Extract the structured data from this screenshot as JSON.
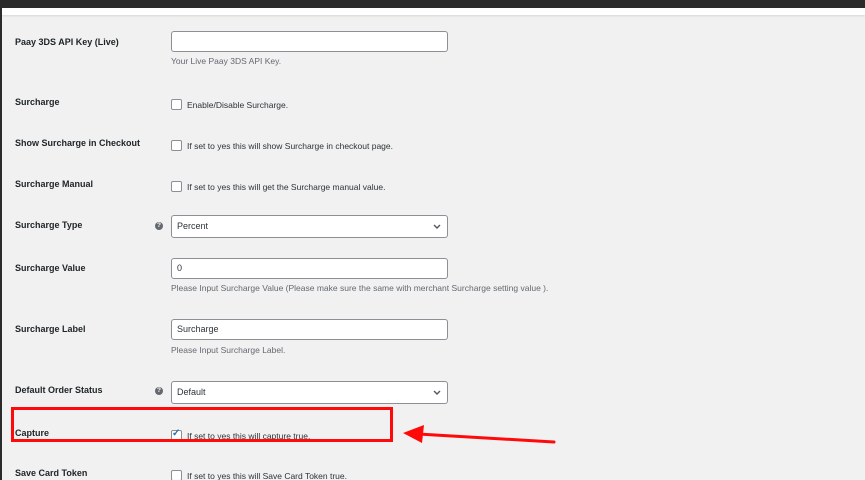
{
  "fields": {
    "api_key_live": {
      "label": "Paay 3DS API Key (Live)",
      "value": "",
      "description": "Your Live Paay 3DS API Key."
    },
    "surcharge": {
      "label": "Surcharge",
      "checkbox_text": "Enable/Disable Surcharge.",
      "checked": false
    },
    "show_surcharge_checkout": {
      "label": "Show Surcharge in Checkout",
      "checkbox_text": "If set to yes this will show Surcharge in checkout page.",
      "checked": false
    },
    "surcharge_manual": {
      "label": "Surcharge Manual",
      "checkbox_text": "If set to yes this will get the Surcharge manual value.",
      "checked": false
    },
    "surcharge_type": {
      "label": "Surcharge Type",
      "selected": "Percent"
    },
    "surcharge_value": {
      "label": "Surcharge Value",
      "value": "0",
      "description": "Please Input Surcharge Value (Please make sure the same with merchant Surcharge setting value )."
    },
    "surcharge_label": {
      "label": "Surcharge Label",
      "value": "Surcharge",
      "description": "Please Input Surcharge Label."
    },
    "default_order_status": {
      "label": "Default Order Status",
      "selected": "Default"
    },
    "capture": {
      "label": "Capture",
      "checkbox_text": "If set to yes this will capture true.",
      "checked": true
    },
    "save_card_token": {
      "label": "Save Card Token",
      "checkbox_text": "If set to yes this will Save Card Token true.",
      "checked": false
    }
  },
  "icons": {
    "help": "question-circle-icon",
    "dropdown": "chevron-down-icon",
    "check": "checkmark-icon"
  },
  "help_glyph": "?",
  "annotation": {
    "highlight_color": "#ff0a0a"
  }
}
